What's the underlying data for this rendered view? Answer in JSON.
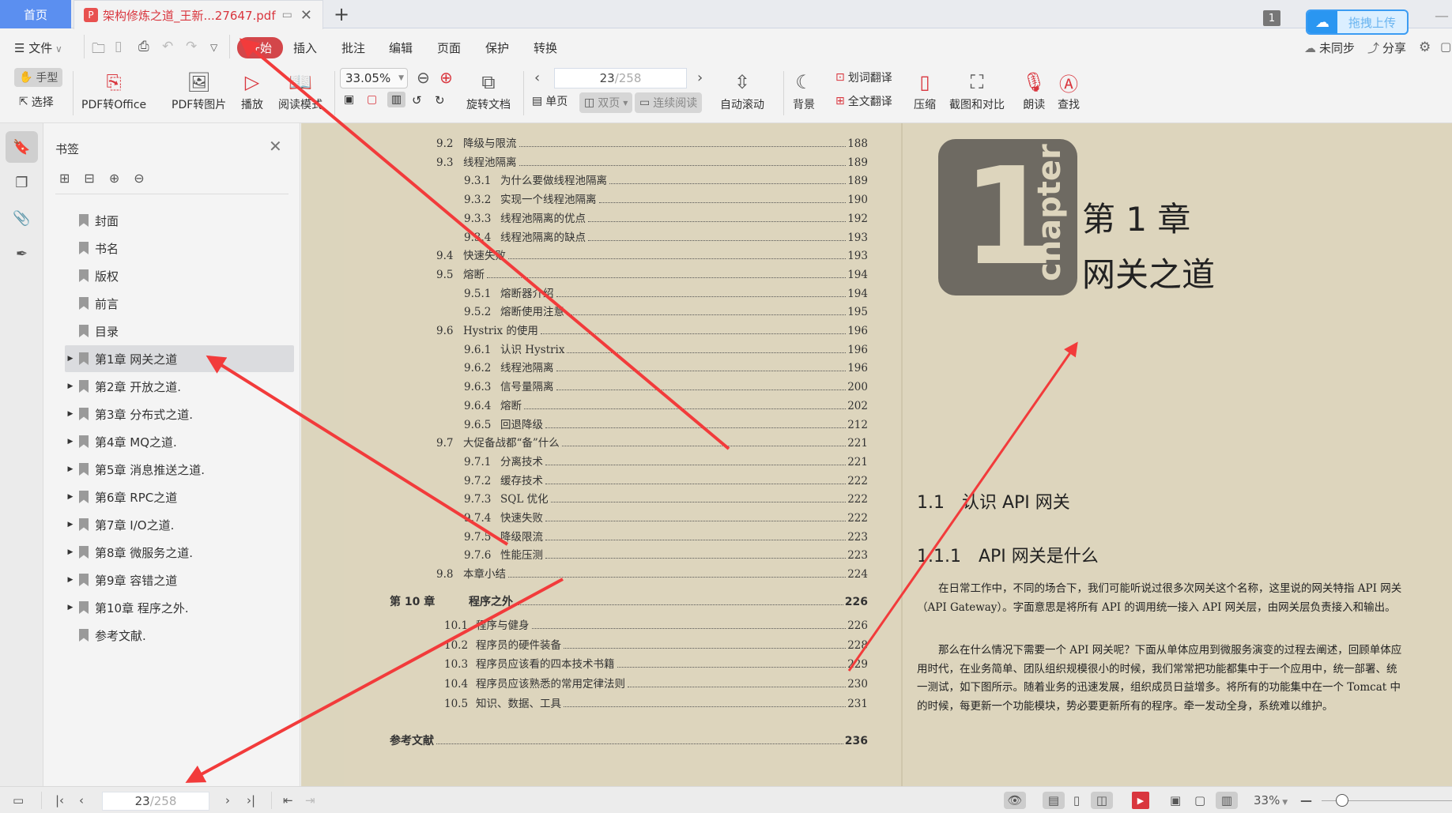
{
  "tabs": {
    "home_label": "首页",
    "doc_title": "架构修炼之道_王新...27647.pdf",
    "add_label": "+"
  },
  "window": {
    "badge_count": "1",
    "upload_label": "拖拽上传"
  },
  "menu": {
    "file_label": "文件",
    "items": [
      "开始",
      "插入",
      "批注",
      "编辑",
      "页面",
      "保护",
      "转换"
    ],
    "active_index": 0,
    "sync_label": "未同步",
    "share_label": "分享"
  },
  "toolbar": {
    "hand_label": "手型",
    "select_label": "选择",
    "pdf_to_office": "PDF转Office",
    "pdf_to_image": "PDF转图片",
    "play": "播放",
    "read_mode": "阅读模式",
    "zoom_value": "33.05%",
    "rotate_doc": "旋转文档",
    "current_page": "23",
    "total_pages": "/258",
    "single_page": "单页",
    "double_page": "双页",
    "continuous": "连续阅读",
    "auto_scroll": "自动滚动",
    "background": "背景",
    "word_translate": "划词翻译",
    "full_translate": "全文翻译",
    "compress": "压缩",
    "screenshot_compare": "截图和对比",
    "read_aloud": "朗读",
    "find": "查找"
  },
  "sidebar": {
    "title": "书签",
    "items": [
      {
        "label": "封面",
        "expandable": false
      },
      {
        "label": "书名",
        "expandable": false
      },
      {
        "label": "版权",
        "expandable": false
      },
      {
        "label": "前言",
        "expandable": false
      },
      {
        "label": "目录",
        "expandable": false
      },
      {
        "label": "第1章 网关之道",
        "expandable": true,
        "selected": true
      },
      {
        "label": "第2章 开放之道.",
        "expandable": true
      },
      {
        "label": "第3章 分布式之道.",
        "expandable": true
      },
      {
        "label": "第4章 MQ之道.",
        "expandable": true
      },
      {
        "label": "第5章 消息推送之道.",
        "expandable": true
      },
      {
        "label": "第6章 RPC之道",
        "expandable": true
      },
      {
        "label": "第7章 I/O之道.",
        "expandable": true
      },
      {
        "label": "第8章 微服务之道.",
        "expandable": true
      },
      {
        "label": "第9章 容错之道",
        "expandable": true
      },
      {
        "label": "第10章 程序之外.",
        "expandable": true
      },
      {
        "label": "参考文献.",
        "expandable": false
      }
    ]
  },
  "toc": [
    {
      "num": "9.2",
      "title": "降级与限流",
      "page": "188",
      "level": 1
    },
    {
      "num": "9.3",
      "title": "线程池隔离",
      "page": "189",
      "level": 1
    },
    {
      "num": "9.3.1",
      "title": "为什么要做线程池隔离",
      "page": "189",
      "level": 2
    },
    {
      "num": "9.3.2",
      "title": "实现一个线程池隔离",
      "page": "190",
      "level": 2
    },
    {
      "num": "9.3.3",
      "title": "线程池隔离的优点",
      "page": "192",
      "level": 2
    },
    {
      "num": "9.3.4",
      "title": "线程池隔离的缺点",
      "page": "193",
      "level": 2
    },
    {
      "num": "9.4",
      "title": "快速失败",
      "page": "193",
      "level": 1
    },
    {
      "num": "9.5",
      "title": "熔断",
      "page": "194",
      "level": 1
    },
    {
      "num": "9.5.1",
      "title": "熔断器介绍",
      "page": "194",
      "level": 2
    },
    {
      "num": "9.5.2",
      "title": "熔断使用注意",
      "page": "195",
      "level": 2
    },
    {
      "num": "9.6",
      "title": "Hystrix 的使用",
      "page": "196",
      "level": 1
    },
    {
      "num": "9.6.1",
      "title": "认识 Hystrix",
      "page": "196",
      "level": 2
    },
    {
      "num": "9.6.2",
      "title": "线程池隔离",
      "page": "196",
      "level": 2
    },
    {
      "num": "9.6.3",
      "title": "信号量隔离",
      "page": "200",
      "level": 2
    },
    {
      "num": "9.6.4",
      "title": "熔断",
      "page": "202",
      "level": 2
    },
    {
      "num": "9.6.5",
      "title": "回退降级",
      "page": "212",
      "level": 2
    },
    {
      "num": "9.7",
      "title": "大促备战都“备”什么",
      "page": "221",
      "level": 1
    },
    {
      "num": "9.7.1",
      "title": "分离技术",
      "page": "221",
      "level": 2
    },
    {
      "num": "9.7.2",
      "title": "缓存技术",
      "page": "222",
      "level": 2
    },
    {
      "num": "9.7.3",
      "title": "SQL 优化",
      "page": "222",
      "level": 2
    },
    {
      "num": "9.7.4",
      "title": "快速失败",
      "page": "222",
      "level": 2
    },
    {
      "num": "9.7.5",
      "title": "降级限流",
      "page": "223",
      "level": 2
    },
    {
      "num": "9.7.6",
      "title": "性能压测",
      "page": "223",
      "level": 2
    },
    {
      "num": "9.8",
      "title": "本章小结",
      "page": "224",
      "level": 1
    },
    {
      "num": "第 10 章",
      "title": "程序之外",
      "page": "226",
      "level": 0
    },
    {
      "num": "10.1",
      "title": "程序与健身",
      "page": "226",
      "level": 3
    },
    {
      "num": "10.2",
      "title": "程序员的硬件装备",
      "page": "228",
      "level": 3
    },
    {
      "num": "10.3",
      "title": "程序员应该看的四本技术书籍",
      "page": "229",
      "level": 3
    },
    {
      "num": "10.4",
      "title": "程序员应该熟悉的常用定律法则",
      "page": "230",
      "level": 3
    },
    {
      "num": "10.5",
      "title": "知识、数据、工具",
      "page": "231",
      "level": 3
    },
    {
      "num": "",
      "title": "参考文献",
      "page": "236",
      "level": 4
    }
  ],
  "chapter_page": {
    "logo_number": "1",
    "logo_word": "chapter",
    "chapter_number": "第 1 章",
    "chapter_title": "网关之道",
    "section_1_1": "1.1　认识 API 网关",
    "section_1_1_1": "1.1.1　API 网关是什么",
    "paragraphs": [
      "在日常工作中，不同的场合下，我们可能听说过很多次网关这个名称，这里说的网关特指 API 网关（API Gateway）。字面意思是将所有 API 的调用统一接入 API 网关层，由网关层负责接入和输出。",
      "那么在什么情况下需要一个 API 网关呢？下面从单体应用到微服务演变的过程去阐述，回顾单体应用时代，在业务简单、团队组织规模很小的时候，我们常常把功能都集中于一个应用中，统一部署、统一测试，如下图所示。随着业务的迅速发展，组织成员日益增多。将所有的功能集中在一个 Tomcat 中的时候，每更新一个功能模块，势必要更新所有的程序。牵一发动全身，系统难以维护。"
    ]
  },
  "statusbar": {
    "current_page": "23",
    "total_pages": "/258",
    "zoom_label": "33%",
    "zoom_fraction": 0.33
  },
  "colors": {
    "accent_red": "#d3464a",
    "tab_blue": "#5b8ff0",
    "page_bg": "#ddd5bd",
    "annotation_arrow": "#f23b3b"
  }
}
